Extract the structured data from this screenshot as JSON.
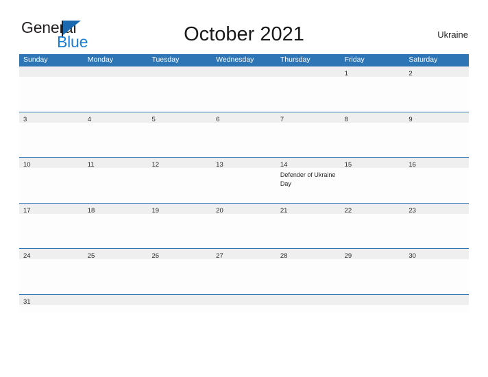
{
  "brand": {
    "name_part1": "General",
    "name_part2": "Blue",
    "flag_icon": "flag-triangle-icon",
    "accent_color": "#1a7fd4"
  },
  "header": {
    "title": "October 2021",
    "locale": "Ukraine"
  },
  "calendar": {
    "header_bg": "#2e75b6",
    "band_bg": "#efefef",
    "weekdays": [
      "Sunday",
      "Monday",
      "Tuesday",
      "Wednesday",
      "Thursday",
      "Friday",
      "Saturday"
    ],
    "weeks": [
      {
        "height": "tall",
        "days": [
          {
            "date": "",
            "events": []
          },
          {
            "date": "",
            "events": []
          },
          {
            "date": "",
            "events": []
          },
          {
            "date": "",
            "events": []
          },
          {
            "date": "",
            "events": []
          },
          {
            "date": "1",
            "events": []
          },
          {
            "date": "2",
            "events": []
          }
        ]
      },
      {
        "height": "tall",
        "days": [
          {
            "date": "3",
            "events": []
          },
          {
            "date": "4",
            "events": []
          },
          {
            "date": "5",
            "events": []
          },
          {
            "date": "6",
            "events": []
          },
          {
            "date": "7",
            "events": []
          },
          {
            "date": "8",
            "events": []
          },
          {
            "date": "9",
            "events": []
          }
        ]
      },
      {
        "height": "tall",
        "days": [
          {
            "date": "10",
            "events": []
          },
          {
            "date": "11",
            "events": []
          },
          {
            "date": "12",
            "events": []
          },
          {
            "date": "13",
            "events": []
          },
          {
            "date": "14",
            "events": [
              "Defender of Ukraine Day"
            ]
          },
          {
            "date": "15",
            "events": []
          },
          {
            "date": "16",
            "events": []
          }
        ]
      },
      {
        "height": "tall",
        "days": [
          {
            "date": "17",
            "events": []
          },
          {
            "date": "18",
            "events": []
          },
          {
            "date": "19",
            "events": []
          },
          {
            "date": "20",
            "events": []
          },
          {
            "date": "21",
            "events": []
          },
          {
            "date": "22",
            "events": []
          },
          {
            "date": "23",
            "events": []
          }
        ]
      },
      {
        "height": "tall",
        "days": [
          {
            "date": "24",
            "events": []
          },
          {
            "date": "25",
            "events": []
          },
          {
            "date": "26",
            "events": []
          },
          {
            "date": "27",
            "events": []
          },
          {
            "date": "28",
            "events": []
          },
          {
            "date": "29",
            "events": []
          },
          {
            "date": "30",
            "events": []
          }
        ]
      },
      {
        "height": "short",
        "days": [
          {
            "date": "31",
            "events": []
          },
          {
            "date": "",
            "events": []
          },
          {
            "date": "",
            "events": []
          },
          {
            "date": "",
            "events": []
          },
          {
            "date": "",
            "events": []
          },
          {
            "date": "",
            "events": []
          },
          {
            "date": "",
            "events": []
          }
        ]
      }
    ]
  }
}
